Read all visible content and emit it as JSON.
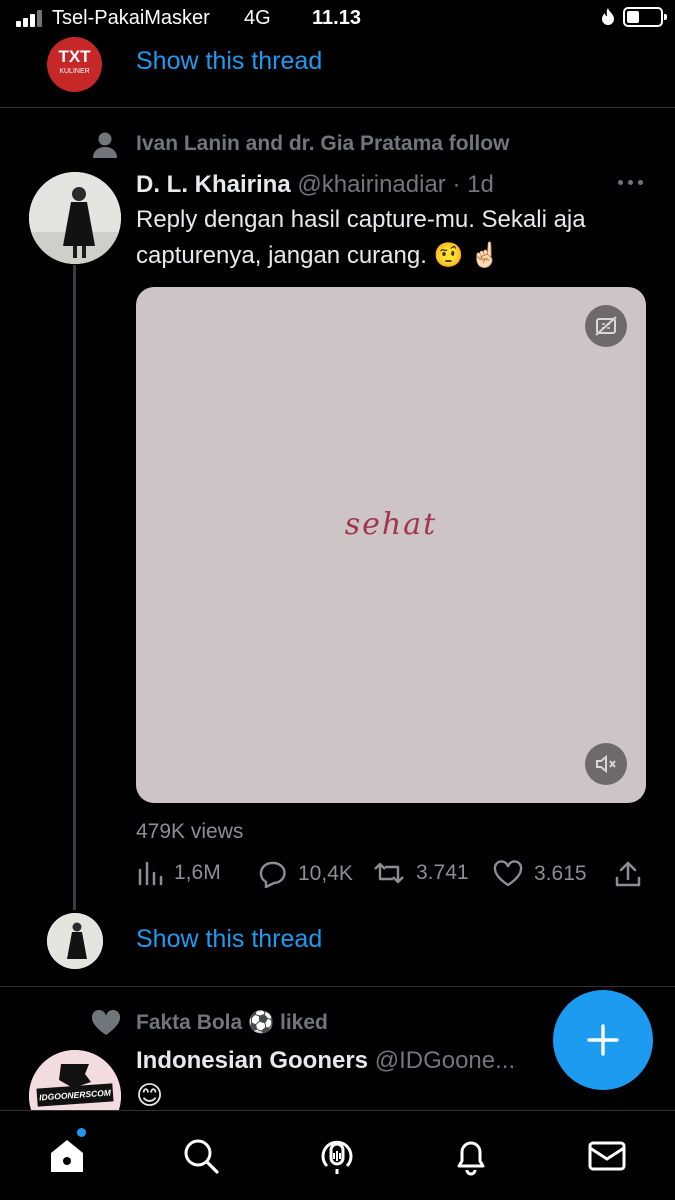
{
  "status_bar": {
    "carrier": "Tsel-PakaiMasker",
    "network": "4G",
    "time": "11.13"
  },
  "top_thread": {
    "avatar_text": "TXT",
    "avatar_subtext": "KULINER",
    "show_thread": "Show this thread"
  },
  "tweet": {
    "social_context": "Ivan Lanin and dr. Gia Pratama follow",
    "author_name": "D. L. Khairina",
    "handle_time": "@khairinadiar · 1d",
    "text_line1": "Reply dengan hasil capture-mu. Sekali aja",
    "text_line2": "capturenya, jangan curang. 🤨 ☝🏻",
    "media_text": "sehat",
    "views": "479K views",
    "stats": {
      "analytics": "1,6M",
      "replies": "10,4K",
      "retweets": "3.741",
      "likes": "3.615"
    },
    "show_thread": "Show this thread"
  },
  "next_tweet": {
    "social_context": "Fakta Bola ⚽ liked",
    "author_name": "Indonesian Gooners",
    "handle": "@IDGoone...",
    "avatar_text": "IDGOONERSCOM",
    "text": "😊"
  },
  "colors": {
    "accent": "#1d9bf0",
    "background": "#000000",
    "muted": "#71767b"
  },
  "icons": [
    "signal-icon",
    "battery-icon",
    "person-icon",
    "more-icon",
    "captions-icon",
    "mute-icon",
    "analytics-icon",
    "reply-icon",
    "retweet-icon",
    "like-icon",
    "share-icon",
    "heart-icon",
    "compose-icon",
    "home-icon",
    "search-icon",
    "spaces-icon",
    "notifications-icon",
    "messages-icon"
  ]
}
